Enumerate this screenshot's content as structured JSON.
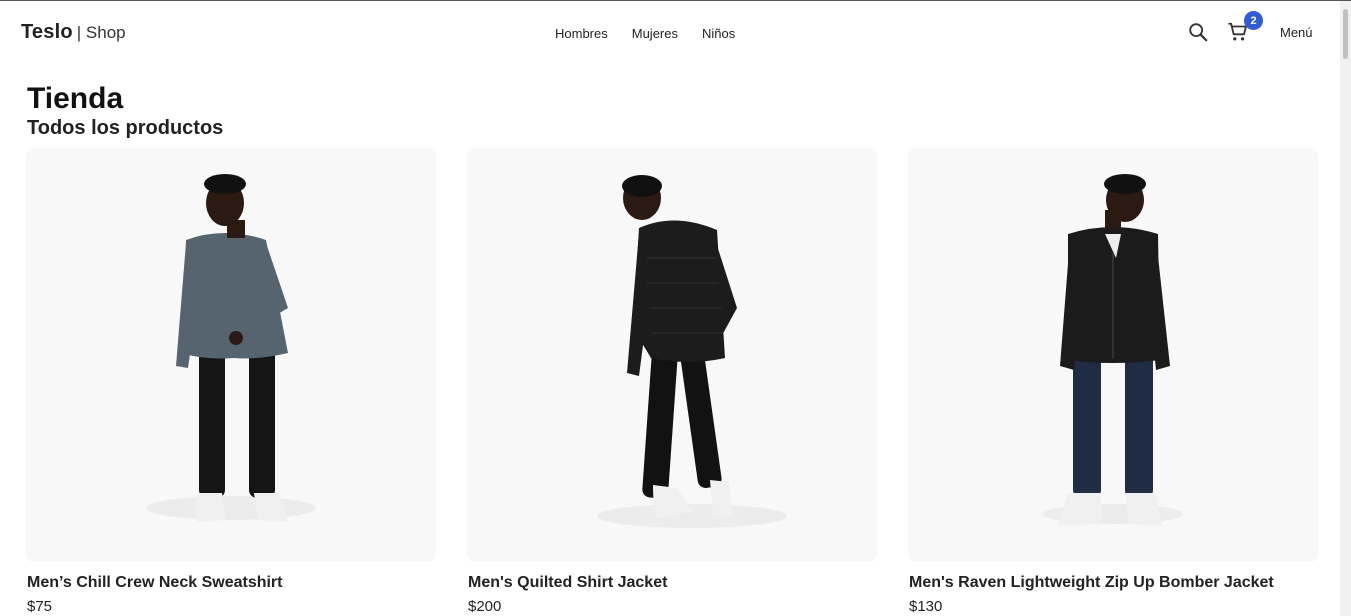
{
  "header": {
    "brand": "Teslo",
    "brand_sub": "| Shop",
    "nav": [
      "Hombres",
      "Mujeres",
      "Niños"
    ],
    "cart_count": "2",
    "menu_label": "Menú",
    "icons": [
      "search-icon",
      "cart-icon"
    ],
    "badge_color": "#2f5bd5"
  },
  "page": {
    "title": "Tienda",
    "subtitle": "Todos los productos"
  },
  "products": [
    {
      "name": "Men’s Chill Crew Neck Sweatshirt",
      "price": "$75",
      "top_color": "#55646e",
      "pants_color": "#151515"
    },
    {
      "name": "Men's Quilted Shirt Jacket",
      "price": "$200",
      "top_color": "#1c1c1c",
      "pants_color": "#121212"
    },
    {
      "name": "Men's Raven Lightweight Zip Up Bomber Jacket",
      "price": "$130",
      "top_color": "#1b1b1b",
      "pants_color": "#1f2c44"
    }
  ]
}
